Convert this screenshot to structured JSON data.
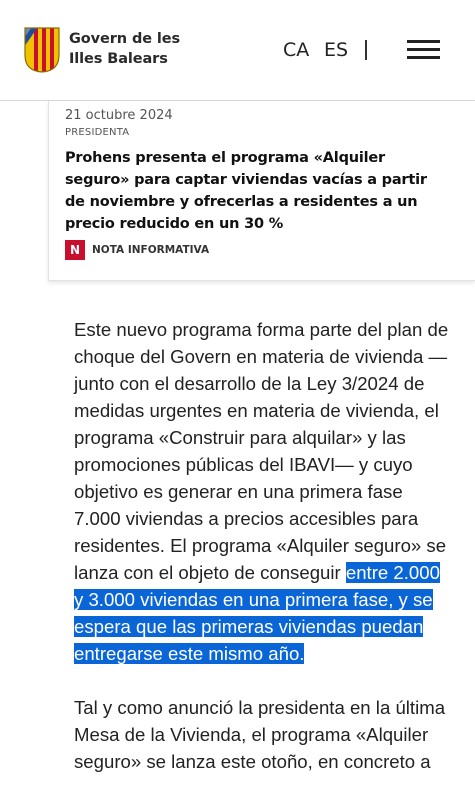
{
  "header": {
    "brand_line1": "Govern de les",
    "brand_line2": "Illes Balears",
    "lang_ca": "CA",
    "lang_es": "ES",
    "colors": {
      "logo_yellow": "#f2c200",
      "logo_red": "#c8102e",
      "logo_blue": "#1f4e9c"
    }
  },
  "card": {
    "date": "21 octubre 2024",
    "section": "PRESIDENTA",
    "title": "Prohens presenta el programa «Alquiler seguro» para captar viviendas vacías a partir de noviembre y ofrecerlas a residentes a un precio reducido en un 30 %",
    "badge_letter": "N",
    "badge_label": "NOTA INFORMATIVA",
    "badge_color": "#c8102e"
  },
  "article": {
    "p1_text": "Este nuevo programa forma parte del plan de choque del Govern en materia de vivienda —junto con el desarrollo de la Ley 3/2024 de medidas urgentes en materia de vivienda, el programa «Construir para alquilar» y las promociones públicas del IBAVI— y cuyo objetivo es generar en una primera fase 7.000 viviendas a precios accesibles para residentes. El programa «Alquiler seguro» se lanza con el objeto de conseguir ",
    "p1_highlight": "entre 2.000 y 3.000 viviendas en una primera fase, y se espera que las primeras viviendas puedan entregarse este mismo año.",
    "p2_text": "Tal y como anunció la presidenta en la última Mesa de la Vivienda, el programa «Alquiler seguro» se lanza este otoño, en concreto a",
    "highlight_color": "#0a66d6"
  }
}
